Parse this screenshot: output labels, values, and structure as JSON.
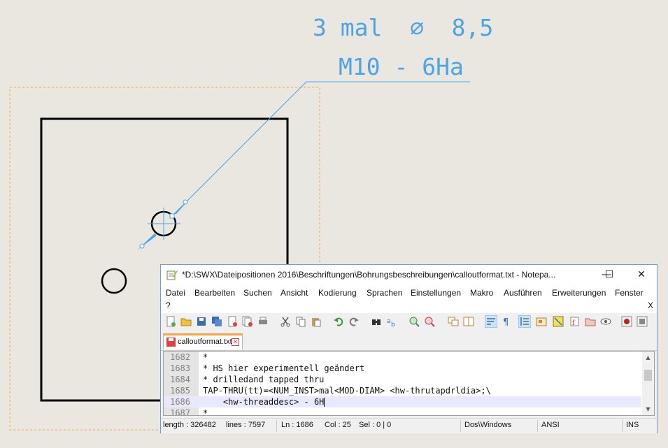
{
  "drawing": {
    "callout_line1": "3 mal  ∅  8,5",
    "callout_line2": "M10 - 6Ha",
    "accent_color": "#4da3e8",
    "frame_color": "#f7a443"
  },
  "window": {
    "title": "*D:\\SWX\\Dateipositionen 2016\\Beschriftungen\\Bohrungsbeschreibungen\\calloutformat.txt - Notepa...",
    "minimize": "—",
    "maximize": "☐",
    "close": "✕"
  },
  "menu": {
    "items": [
      "Datei",
      "Bearbeiten",
      "Suchen",
      "Ansicht",
      "Kodierung",
      "Sprachen",
      "Einstellungen",
      "Makro",
      "Ausführen",
      "Erweiterungen",
      "Fenster"
    ],
    "help": "?",
    "close_doc": "X"
  },
  "toolbar": {
    "icons": [
      "new-icon",
      "open-icon",
      "save-icon",
      "save-all-icon",
      "close-icon",
      "close-all-icon",
      "print-icon",
      "cut-icon",
      "copy-icon",
      "paste-icon",
      "undo-icon",
      "redo-icon",
      "find-icon",
      "replace-icon",
      "zoom-in-icon",
      "zoom-out-icon",
      "sync-v-icon",
      "sync-h-icon",
      "word-wrap-icon",
      "show-all-chars-icon",
      "indent-guide-icon",
      "udl-icon",
      "doc-map-icon",
      "function-list-icon",
      "folder-workspace-icon",
      "monitor-icon",
      "record-macro-icon",
      "stop-record-icon"
    ]
  },
  "tab": {
    "label": "calloutformat.txt",
    "close": "✕"
  },
  "editor": {
    "lines": [
      {
        "num": "1682",
        "text": "*"
      },
      {
        "num": "1683",
        "text": "* HS hier experimentell geändert"
      },
      {
        "num": "1684",
        "text": "* drilledand tapped thru"
      },
      {
        "num": "1685",
        "text": "TAP-THRU(tt)=<NUM_INST>mal<MOD-DIAM> <hw-thrutapdrldia>;\\"
      },
      {
        "num": "1686",
        "text": "    <hw-threaddesc> - 6H"
      },
      {
        "num": "1687",
        "text": "*"
      }
    ],
    "current_line_index": 4
  },
  "status": {
    "length": "length : 326482",
    "lines": "lines : 7597",
    "ln": "Ln : 1686",
    "col": "Col : 25",
    "sel": "Sel : 0 | 0",
    "eol": "Dos\\Windows",
    "encoding": "ANSI",
    "mode": "INS"
  }
}
